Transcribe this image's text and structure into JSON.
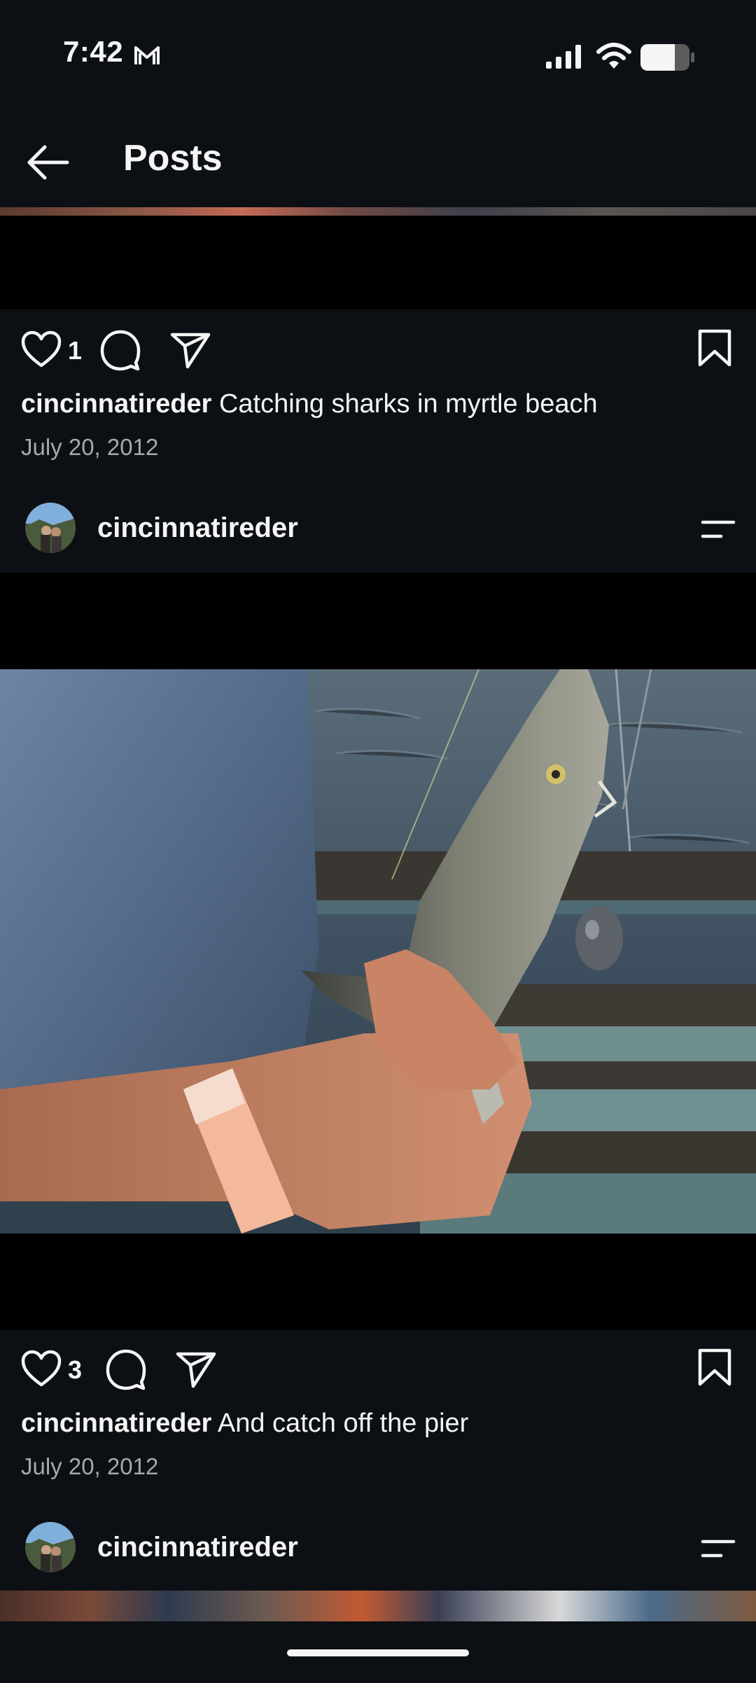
{
  "status_bar": {
    "time": "7:42"
  },
  "header": {
    "title": "Posts"
  },
  "posts": [
    {
      "like_count": "1",
      "username": "cincinnatireder",
      "caption": "Catching sharks in myrtle beach",
      "date": "July 20, 2012"
    },
    {
      "username": "cincinnatireder",
      "like_count": "3",
      "caption": "And catch off the pier",
      "date": "July 20, 2012"
    },
    {
      "username": "cincinnatireder"
    }
  ],
  "icons": {
    "mail": "gmail-icon",
    "signal": "cellular-signal-icon",
    "wifi": "wifi-icon",
    "battery": "battery-icon",
    "back": "arrow-left-icon",
    "like": "heart-icon",
    "comment": "comment-bubble-icon",
    "share": "paper-plane-icon",
    "save": "bookmark-icon",
    "more": "menu-lines-icon"
  },
  "colors": {
    "background": "#0c1014",
    "text": "#f5f5f5",
    "secondary_text": "#a8a8a8"
  }
}
